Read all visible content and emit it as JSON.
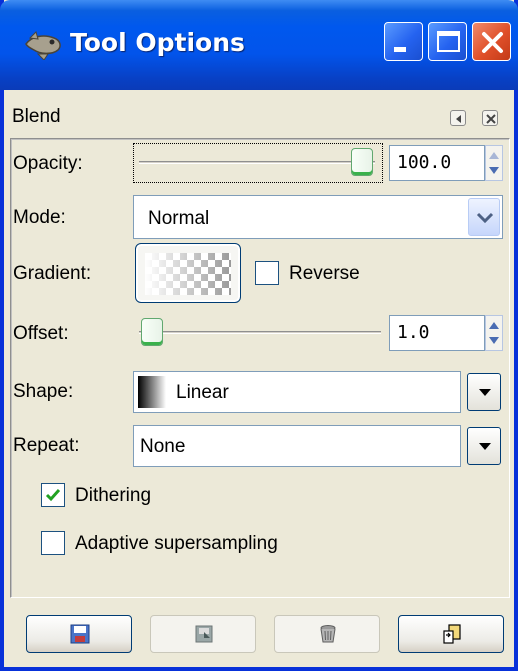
{
  "window": {
    "title": "Tool Options",
    "title_bar_color": "#0058ee",
    "caption_buttons": [
      "minimize-icon",
      "maximize-icon",
      "close-icon"
    ]
  },
  "dock": {
    "title": "Blend",
    "header_buttons": [
      "menu-arrow-icon",
      "dock-close-icon"
    ]
  },
  "options": {
    "opacity": {
      "label": "Opacity:",
      "value": "100.0",
      "fraction": 1.0
    },
    "mode": {
      "label": "Mode:",
      "selected": "Normal"
    },
    "gradient": {
      "label": "Gradient:",
      "reverse_label": "Reverse",
      "reverse_checked": false
    },
    "offset": {
      "label": "Offset:",
      "value": "1.0",
      "fraction": 0.0
    },
    "shape": {
      "label": "Shape:",
      "selected": "Linear"
    },
    "repeat": {
      "label": "Repeat:",
      "selected": "None"
    },
    "dithering": {
      "label": "Dithering",
      "checked": true
    },
    "adaptive": {
      "label": "Adaptive supersampling",
      "checked": false
    }
  },
  "bottom_buttons": [
    {
      "icon": "save-icon",
      "enabled": true
    },
    {
      "icon": "restore-icon",
      "enabled": false
    },
    {
      "icon": "delete-icon",
      "enabled": false
    },
    {
      "icon": "reset-icon",
      "enabled": true
    }
  ],
  "colors": {
    "accent_green": "#3ab14b",
    "check_green": "#21a121",
    "xp_blue": "#0831d9"
  }
}
